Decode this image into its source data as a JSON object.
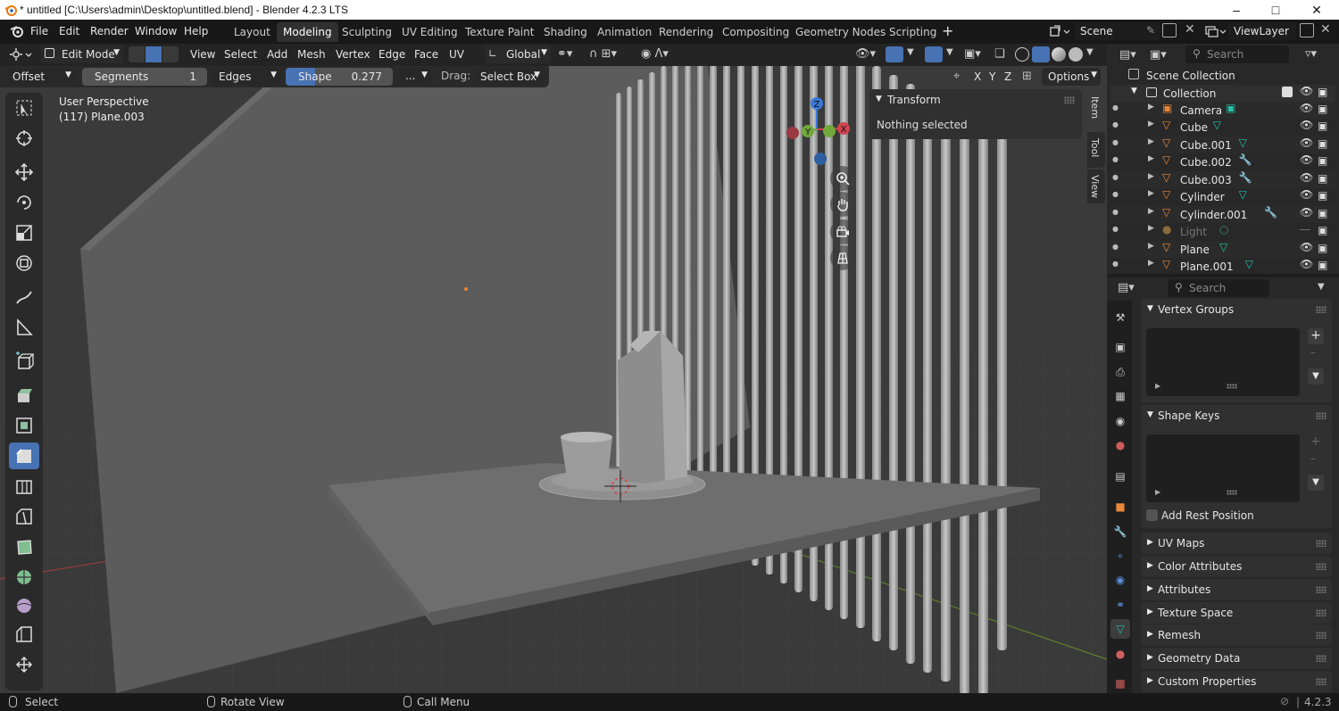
{
  "window": {
    "title": "* untitled [C:\\Users\\admin\\Desktop\\untitled.blend] - Blender 4.2.3 LTS"
  },
  "menu": [
    "File",
    "Edit",
    "Render",
    "Window",
    "Help"
  ],
  "workspaces": [
    {
      "label": "Layout",
      "active": false
    },
    {
      "label": "Modeling",
      "active": true
    },
    {
      "label": "Sculpting",
      "active": false
    },
    {
      "label": "UV Editing",
      "active": false
    },
    {
      "label": "Texture Paint",
      "active": false
    },
    {
      "label": "Shading",
      "active": false
    },
    {
      "label": "Animation",
      "active": false
    },
    {
      "label": "Rendering",
      "active": false
    },
    {
      "label": "Compositing",
      "active": false
    },
    {
      "label": "Geometry Nodes",
      "active": false
    },
    {
      "label": "Scripting",
      "active": false
    }
  ],
  "scene": {
    "name": "Scene",
    "view_layer": "ViewLayer"
  },
  "viewport_header": {
    "mode": "Edit Mode",
    "menus": [
      "View",
      "Select",
      "Add",
      "Mesh",
      "Vertex",
      "Edge",
      "Face",
      "UV"
    ],
    "orientation": "Global",
    "axes": [
      "X",
      "Y",
      "Z"
    ],
    "options": "Options"
  },
  "operator": {
    "offset": "Offset",
    "segments_label": "Segments",
    "segments_value": "1",
    "affect": "Edges",
    "shape_label": "Shape",
    "shape_value": "0.277",
    "more": "...",
    "drag_label": "Drag:",
    "drag_value": "Select Box"
  },
  "viewport": {
    "perspective": "User Perspective",
    "object": "(117) Plane.003",
    "gizmo": {
      "x": "X",
      "y": "Y",
      "z": "Z"
    }
  },
  "npanel": {
    "section": "Transform",
    "message": "Nothing selected",
    "tabs": [
      "Item",
      "Tool",
      "View"
    ]
  },
  "outliner": {
    "search_placeholder": "Search",
    "scene_collection": "Scene Collection",
    "collection": "Collection",
    "items": [
      {
        "name": "Camera",
        "icon": "camera-icon",
        "data_icon": "camera-data-icon",
        "dim": false
      },
      {
        "name": "Cube",
        "icon": "mesh-icon",
        "data_icon": "mesh-data-icon",
        "dim": false
      },
      {
        "name": "Cube.001",
        "icon": "mesh-icon",
        "data_icon": "mesh-data-icon",
        "dim": false
      },
      {
        "name": "Cube.002",
        "icon": "mesh-icon",
        "data_icon": "wrench-modifier-icon",
        "dim": false
      },
      {
        "name": "Cube.003",
        "icon": "mesh-icon",
        "data_icon": "wrench-modifier-icon",
        "dim": false
      },
      {
        "name": "Cylinder",
        "icon": "mesh-icon",
        "data_icon": "mesh-data-icon",
        "dim": false
      },
      {
        "name": "Cylinder.001",
        "icon": "mesh-icon",
        "data_icon": "wrench-modifier-icon",
        "dim": false
      },
      {
        "name": "Light",
        "icon": "light-icon",
        "data_icon": "light-data-icon",
        "dim": true
      },
      {
        "name": "Plane",
        "icon": "mesh-icon",
        "data_icon": "mesh-data-icon",
        "dim": false
      },
      {
        "name": "Plane.001",
        "icon": "mesh-icon",
        "data_icon": "mesh-data-icon",
        "dim": false
      }
    ]
  },
  "properties": {
    "search_placeholder": "Search",
    "vertex_groups": "Vertex Groups",
    "shape_keys": "Shape Keys",
    "add_rest_position": "Add Rest Position",
    "sections": [
      "UV Maps",
      "Color Attributes",
      "Attributes",
      "Texture Space",
      "Remesh",
      "Geometry Data",
      "Custom Properties"
    ]
  },
  "status": {
    "select": "Select",
    "rotate": "Rotate View",
    "call_menu": "Call Menu",
    "version": "4.2.3"
  },
  "colors": {
    "accent": "#4772b3",
    "x_axis": "#d2444f",
    "y_axis": "#71a83c",
    "z_axis": "#3a78d8",
    "mesh_orange": "#e8883a",
    "data_green": "#26c1a6"
  }
}
